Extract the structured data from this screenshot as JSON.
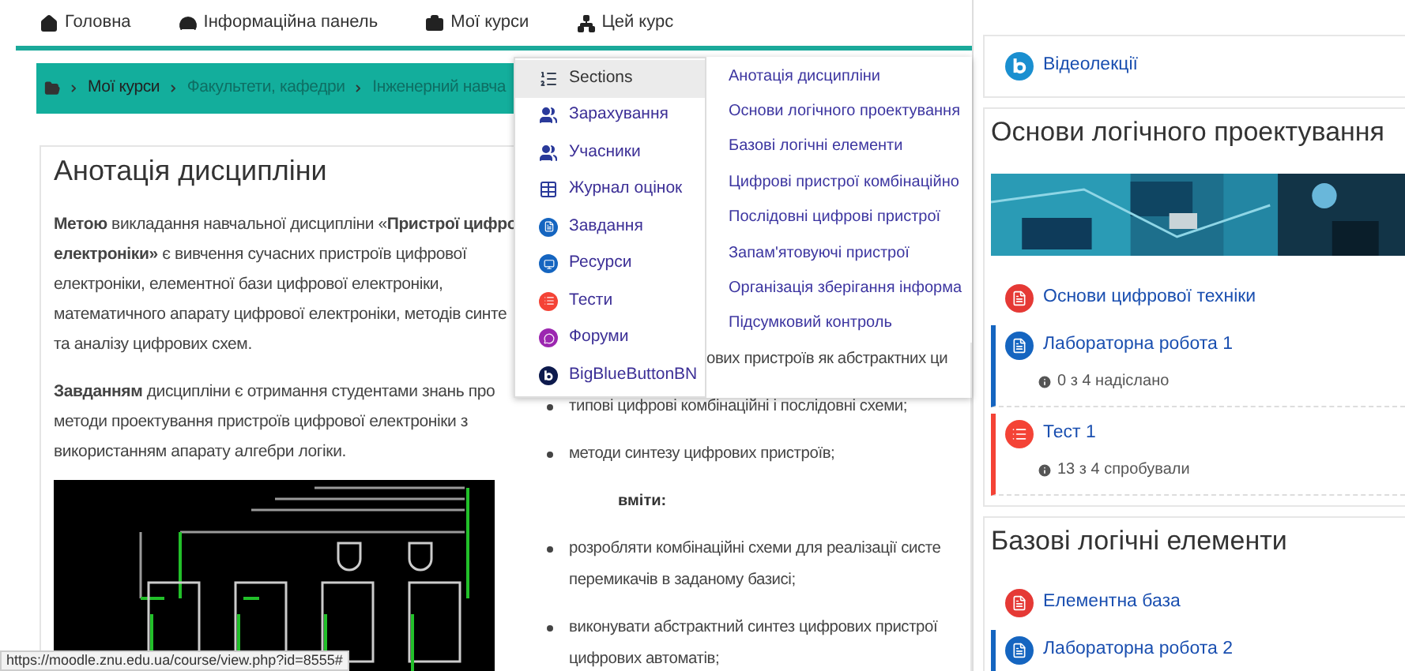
{
  "nav": [
    {
      "label": "Головна",
      "kind": "home"
    },
    {
      "label": "Інформаційна панель",
      "kind": "dashboard"
    },
    {
      "label": "Мої курси",
      "kind": "courses"
    },
    {
      "label": "Цей курс",
      "kind": "course"
    }
  ],
  "breadcrumb": [
    {
      "label": "Мої курси",
      "dimmed": false
    },
    {
      "label": "Факультети, кафедри",
      "dimmed": true
    },
    {
      "label": "Інженерний навча",
      "dimmed": true
    }
  ],
  "course_menu": [
    {
      "label": "Sections",
      "kind": "sections",
      "selected": true
    },
    {
      "label": "Зарахування",
      "kind": "enrol",
      "selected": false
    },
    {
      "label": "Учасники",
      "kind": "participants",
      "selected": false
    },
    {
      "label": "Журнал оцінок",
      "kind": "grades",
      "selected": false
    },
    {
      "label": "Завдання",
      "kind": "assign",
      "selected": false
    },
    {
      "label": "Ресурси",
      "kind": "resource",
      "selected": false
    },
    {
      "label": "Тести",
      "kind": "quiz",
      "selected": false
    },
    {
      "label": "Форуми",
      "kind": "forum",
      "selected": false
    },
    {
      "label": "BigBlueButtonBN",
      "kind": "bbb",
      "selected": false
    }
  ],
  "sections_menu": [
    "Анотація дисципліни",
    "Основи логічного проектування",
    "Базові логічні елементи",
    "Цифрові пристрої комбінаційно",
    "Послідовні цифрові пристрої",
    "Запам'ятовуючі пристрої",
    "Організація зберігання інформа",
    "Підсумковий контроль"
  ],
  "annotation": {
    "title": "Анотація дисципліни",
    "paragraphs": [
      [
        "**Метою** викладання навчальної дисципліни «**Пристрої цифро**",
        "**електроніки»** є вивчення сучасних пристроїв цифрової",
        "електроніки, елементної бази цифрової електроніки,",
        "математичного апарату цифрової електроніки, методів синте",
        "та аналізу цифрових схем."
      ],
      [
        "**Завданням** дисципліни є отримання студентами знань про",
        "методи проектування пристроїв цифрової електроніки з",
        "використанням апарату алгебри логіки."
      ]
    ]
  },
  "outcomes": [
    {
      "kind": "text",
      "lines": [
        "ових пристроїв як абстрактних ци"
      ]
    },
    {
      "kind": "bullet",
      "lines": [
        "типові цифрові комбінаційні і послідовні схеми;"
      ]
    },
    {
      "kind": "bullet",
      "lines": [
        "методи синтезу цифрових пристроїв;"
      ]
    },
    {
      "kind": "heading",
      "lines": [
        "вміти:"
      ]
    },
    {
      "kind": "bullet",
      "lines": [
        "розробляти комбінаційні схеми для реалізації систе",
        "перемикачів в заданому базисі;"
      ]
    },
    {
      "kind": "bullet",
      "lines": [
        "виконувати абстрактний синтез цифрових пристрої",
        "цифрових автоматів;"
      ]
    }
  ],
  "status_url": "https://moodle.znu.edu.ua/course/view.php?id=8555#",
  "side": [
    {
      "activities": [
        {
          "kind": "bbb",
          "label": "Відеолекції"
        }
      ]
    },
    {
      "title": "Основи логічного проектування",
      "image": {
        "kind": "picture"
      },
      "activities": [
        {
          "kind": "pdf",
          "label": "Основи цифрової техніки"
        },
        {
          "kind": "assign",
          "label": "Лабораторна робота 1",
          "info": "0 з 4 надіслано",
          "color": "#1565c0"
        },
        {
          "kind": "quiz",
          "label": "Тест 1",
          "info": "13 з 4 спробували",
          "color": "#f44336"
        }
      ]
    },
    {
      "title": "Базові логічні елементи",
      "activities": [
        {
          "kind": "pdf",
          "label": "Елементна база"
        },
        {
          "kind": "assign",
          "label": "Лабораторна робота 2",
          "color": "#1565c0"
        }
      ]
    }
  ]
}
